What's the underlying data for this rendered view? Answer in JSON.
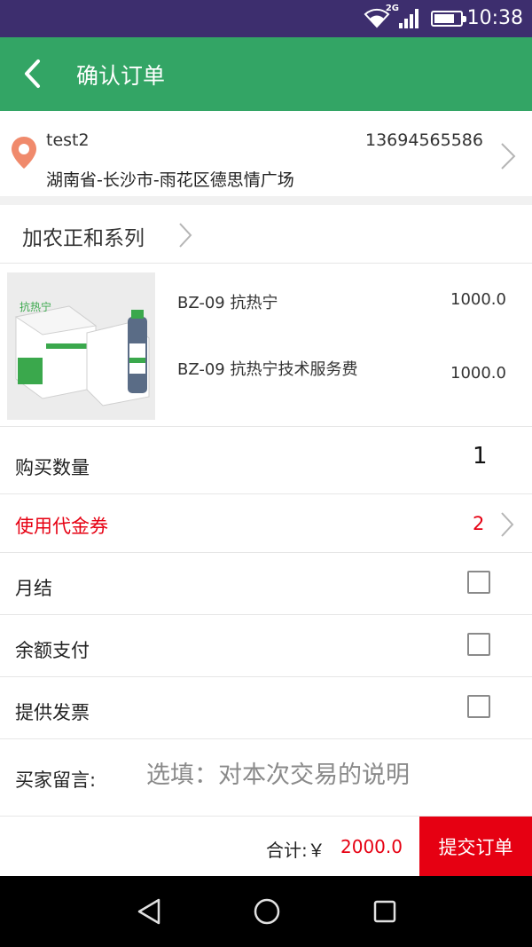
{
  "status_bar": {
    "time": "10:38",
    "network": "2G",
    "icons": [
      "wifi-icon",
      "signal-icon",
      "battery-icon"
    ]
  },
  "header": {
    "title": "确认订单",
    "back_icon": "chevron-left-icon",
    "background": "#33a565"
  },
  "address": {
    "name": "test2",
    "phone": "13694565586",
    "detail": "湖南省-长沙市-雨花区德思情广场",
    "pin_color": "#f08a6c"
  },
  "store": {
    "name": "加农正和系列"
  },
  "product": {
    "image_label": "抗热宁",
    "items": [
      {
        "name": "BZ-09 抗热宁",
        "price": "1000.0"
      },
      {
        "name": "BZ-09 抗热宁技术服务费",
        "price": "1000.0"
      }
    ]
  },
  "quantity": {
    "label": "购买数量",
    "value": "1"
  },
  "coupon": {
    "label": "使用代金券",
    "count": "2",
    "color": "#e60012"
  },
  "options": [
    {
      "label": "月结",
      "checked": false
    },
    {
      "label": "余额支付",
      "checked": false
    },
    {
      "label": "提供发票",
      "checked": false
    }
  ],
  "message": {
    "label": "买家留言:",
    "placeholder": "选填：对本次交易的说明",
    "value": ""
  },
  "footer": {
    "total_label": "合计:￥",
    "total_value": "2000.0",
    "submit_label": "提交订单",
    "accent": "#e60012"
  },
  "nav": {
    "icons": [
      "back-triangle-icon",
      "home-circle-icon",
      "recents-square-icon"
    ]
  }
}
